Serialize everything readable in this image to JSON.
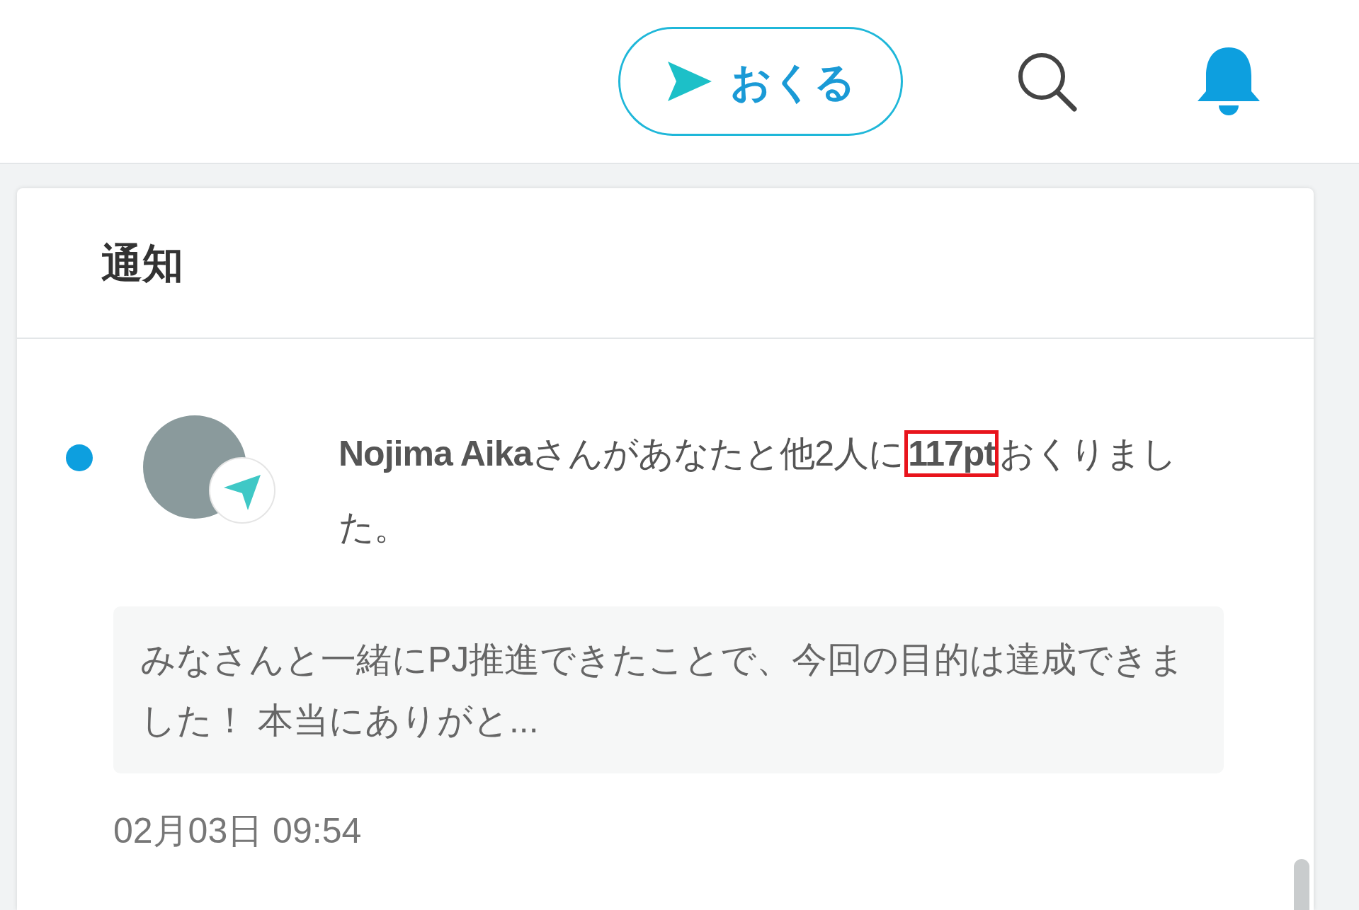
{
  "header": {
    "send_button": "おくる"
  },
  "panel": {
    "title": "通知",
    "notifications": [
      {
        "unread": true,
        "sender": "Nojima Aika",
        "text": "さんがあなたと他2人に",
        "points": "117pt",
        "points_highlighted": true,
        "text_end": "おくりました。",
        "quote": "みなさんと一緒にPJ推進できたことで、今回の目的は達成できました！ 本当にありがと...",
        "time": "02月03日 09:54"
      }
    ]
  }
}
